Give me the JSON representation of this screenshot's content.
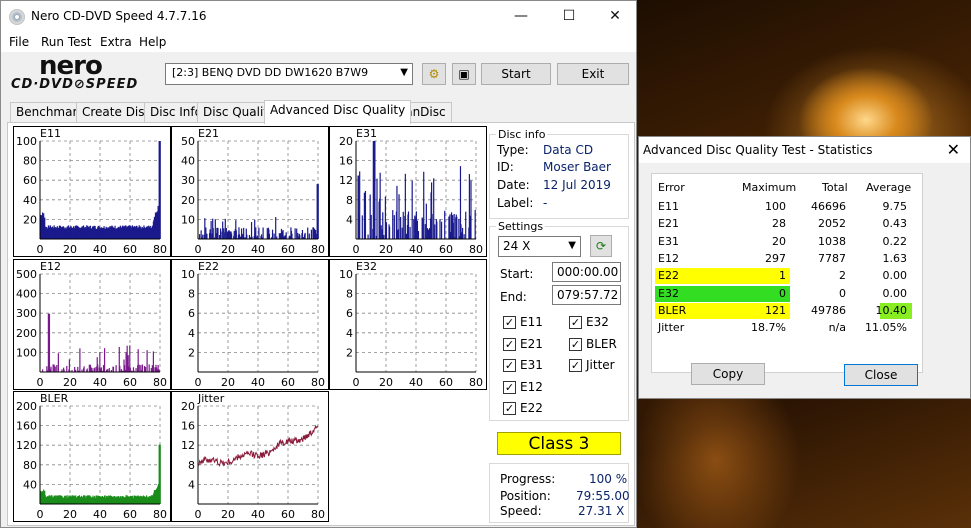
{
  "window": {
    "title": "Nero CD-DVD Speed 4.7.7.16",
    "min": "—",
    "max": "☐",
    "close": "✕"
  },
  "menu": [
    "File",
    "Run Test",
    "Extra",
    "Help"
  ],
  "logo": {
    "top": "nero",
    "bottom": "CD·DVD⊘SPEED"
  },
  "toolbar": {
    "drive": "[2:3]  BENQ DVD DD DW1620 B7W9",
    "start": "Start",
    "exit": "Exit"
  },
  "tabs": [
    "Benchmark",
    "Create Disc",
    "Disc Info",
    "Disc Quality",
    "Advanced Disc Quality",
    "ScanDisc"
  ],
  "active_tab": 4,
  "disc_info": {
    "title": "Disc info",
    "rows": [
      {
        "label": "Type:",
        "value": "Data CD"
      },
      {
        "label": "ID:",
        "value": "Moser Baer"
      },
      {
        "label": "Date:",
        "value": "12 Jul 2019"
      },
      {
        "label": "Label:",
        "value": "-"
      }
    ]
  },
  "settings": {
    "title": "Settings",
    "speed": "24 X",
    "start_label": "Start:",
    "start_value": "000:00.00",
    "end_label": "End:",
    "end_value": "079:57.72",
    "checks_left": [
      "E11",
      "E21",
      "E31",
      "E12",
      "E22"
    ],
    "checks_right": [
      "E32",
      "BLER",
      "Jitter"
    ]
  },
  "class_label": "Class 3",
  "progress": {
    "progress_label": "Progress:",
    "progress_value": "100 %",
    "position_label": "Position:",
    "position_value": "79:55.00",
    "speed_label": "Speed:",
    "speed_value": "27.31 X"
  },
  "stats": {
    "title": "Advanced Disc Quality Test - Statistics",
    "close": "✕",
    "headers": [
      "Error",
      "Maximum",
      "Total",
      "Average"
    ],
    "rows": [
      {
        "error": "E11",
        "maximum": "100",
        "total": "46696",
        "average": "9.75"
      },
      {
        "error": "E21",
        "maximum": "28",
        "total": "2052",
        "average": "0.43"
      },
      {
        "error": "E31",
        "maximum": "20",
        "total": "1038",
        "average": "0.22"
      },
      {
        "error": "E12",
        "maximum": "297",
        "total": "7787",
        "average": "1.63"
      },
      {
        "error": "E22",
        "maximum": "1",
        "total": "2",
        "average": "0.00"
      },
      {
        "error": "E32",
        "maximum": "0",
        "total": "0",
        "average": "0.00"
      },
      {
        "error": "BLER",
        "maximum": "121",
        "total": "49786",
        "average": "10.40"
      },
      {
        "error": "Jitter",
        "maximum": "18.7%",
        "total": "n/a",
        "average": "11.05%"
      }
    ],
    "row_colors": {
      "E22": "#ffff00",
      "E32": "#33dd22",
      "BLER": "#ffff00",
      "BLER_avg": "#88ee22"
    },
    "copy": "Copy",
    "close_btn": "Close"
  },
  "chart_data": [
    {
      "type": "bar",
      "title": "E11",
      "color": "#1a1a8c",
      "ylim": [
        0,
        100
      ],
      "yticks": [
        20,
        40,
        60,
        80,
        100
      ],
      "xticks": [
        0,
        20,
        40,
        60,
        80
      ],
      "xlim": [
        0,
        80
      ],
      "profile": "e11"
    },
    {
      "type": "bar",
      "title": "E21",
      "color": "#1a1a8c",
      "ylim": [
        0,
        50
      ],
      "yticks": [
        10,
        20,
        30,
        40,
        50
      ],
      "xticks": [
        0,
        20,
        40,
        60,
        80
      ],
      "xlim": [
        0,
        80
      ],
      "profile": "e21"
    },
    {
      "type": "bar",
      "title": "E31",
      "color": "#1a1a8c",
      "ylim": [
        0,
        20
      ],
      "yticks": [
        4,
        8,
        12,
        16,
        20
      ],
      "xticks": [
        0,
        20,
        40,
        60,
        80
      ],
      "xlim": [
        0,
        80
      ],
      "profile": "e31"
    },
    {
      "type": "bar",
      "title": "E12",
      "color": "#7a1a8c",
      "ylim": [
        0,
        500
      ],
      "yticks": [
        100,
        200,
        300,
        400,
        500
      ],
      "xticks": [
        0,
        20,
        40,
        60,
        80
      ],
      "xlim": [
        0,
        80
      ],
      "profile": "e12"
    },
    {
      "type": "bar",
      "title": "E22",
      "color": "#7a1a8c",
      "ylim": [
        0,
        10
      ],
      "yticks": [
        2,
        4,
        6,
        8,
        10
      ],
      "xticks": [
        0,
        20,
        40,
        60,
        80
      ],
      "xlim": [
        0,
        80
      ],
      "profile": "zero"
    },
    {
      "type": "bar",
      "title": "E32",
      "color": "#7a1a8c",
      "ylim": [
        0,
        10
      ],
      "yticks": [
        2,
        4,
        6,
        8,
        10
      ],
      "xticks": [
        0,
        20,
        40,
        60,
        80
      ],
      "xlim": [
        0,
        80
      ],
      "profile": "zero"
    },
    {
      "type": "bar",
      "title": "BLER",
      "color": "#1a8c1a",
      "ylim": [
        0,
        200
      ],
      "yticks": [
        40,
        80,
        120,
        160,
        200
      ],
      "xticks": [
        0,
        20,
        40,
        60,
        80
      ],
      "xlim": [
        0,
        80
      ],
      "profile": "bler"
    },
    {
      "type": "line",
      "title": "Jitter",
      "color": "#8c1a3a",
      "ylim": [
        0,
        20
      ],
      "yticks": [
        4,
        8,
        12,
        16,
        20
      ],
      "xticks": [
        0,
        20,
        40,
        60,
        80
      ],
      "xlim": [
        0,
        80
      ],
      "profile": "jitter"
    }
  ]
}
